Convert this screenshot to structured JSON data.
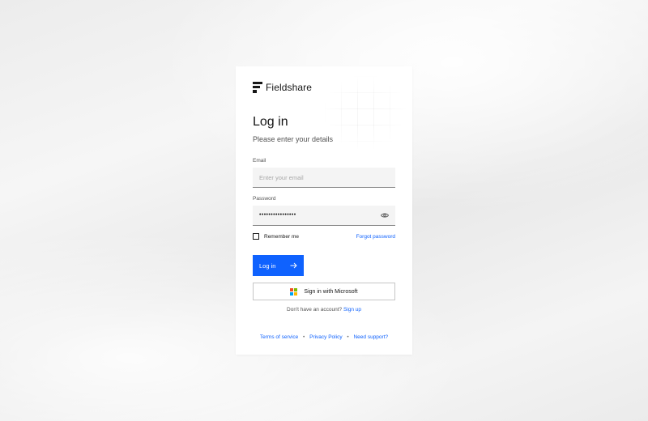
{
  "brand": {
    "name": "Fieldshare"
  },
  "login": {
    "title": "Log in",
    "subtitle": "Please enter your details",
    "email_label": "Email",
    "email_placeholder": "Enter your email",
    "email_value": "",
    "password_label": "Password",
    "password_value": "••••••••••••••••",
    "password_icon": "eye-icon",
    "remember_label": "Remember me",
    "remember_checked": false,
    "forgot_label": "Forgot password",
    "submit_label": "Log in",
    "submit_icon": "arrow-right-icon",
    "microsoft_label": "Sign in with Microsoft",
    "signup_prompt": "Don't have an account?",
    "signup_link": "Sign up"
  },
  "footer": {
    "links": [
      "Terms of service",
      "Privacy Policy",
      "Need support?"
    ],
    "separator": "•"
  },
  "colors": {
    "primary": "#0f62fe",
    "text": "#161616",
    "field_bg": "#f4f4f4",
    "microsoft": [
      "#f25022",
      "#7fba00",
      "#00a4ef",
      "#ffb900"
    ]
  }
}
